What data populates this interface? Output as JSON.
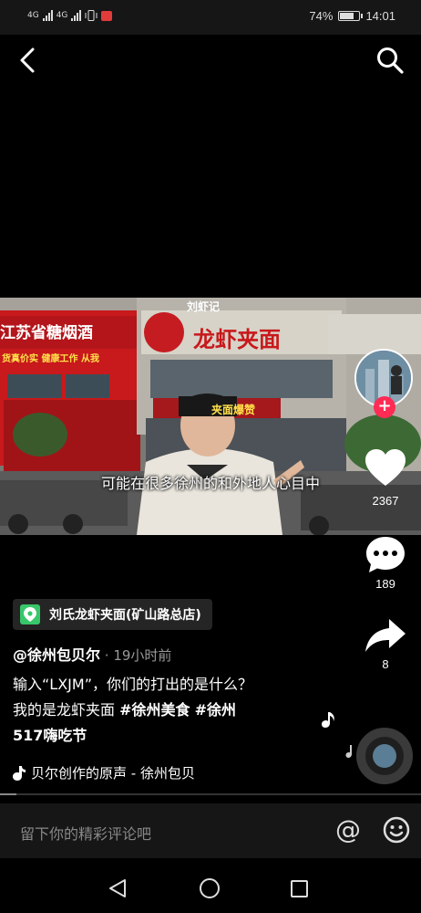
{
  "status_bar": {
    "network_1": "4G",
    "network_2": "4G",
    "battery_percent": "74%",
    "battery_level": 0.74,
    "time": "14:01"
  },
  "video": {
    "subtitle": "可能在很多徐州的和外地人心目中",
    "sign_left": "江苏省糖烟酒",
    "sign_left_sub": "货真价实 健康工作 从我",
    "sign_main": "龙虾夹面",
    "sign_top": "刘虾记",
    "sign_banner": "夹面爆赞",
    "progress": 0.04
  },
  "rail": {
    "likes": "2367",
    "comments": "189",
    "shares": "8"
  },
  "poi": {
    "name": "刘氏龙虾夹面(矿山路总店)"
  },
  "post": {
    "author": "@徐州包贝尔",
    "separator": " · ",
    "time": "19小时前",
    "caption_line1": "输入“LXJM”，你们的打出的是什么？",
    "caption_line2_prefix": "我的是龙虾夹面 ",
    "tag1": "#徐州美食",
    "tag2": "#徐州",
    "tag2_cont": "517嗨吃节",
    "music": "贝尔创作的原声 - 徐州包贝"
  },
  "comment_bar": {
    "placeholder": "留下你的精彩评论吧",
    "at_symbol": "@"
  },
  "colors": {
    "accent": "#fe2c55",
    "poi_green": "#38c76a",
    "background": "#000000"
  }
}
